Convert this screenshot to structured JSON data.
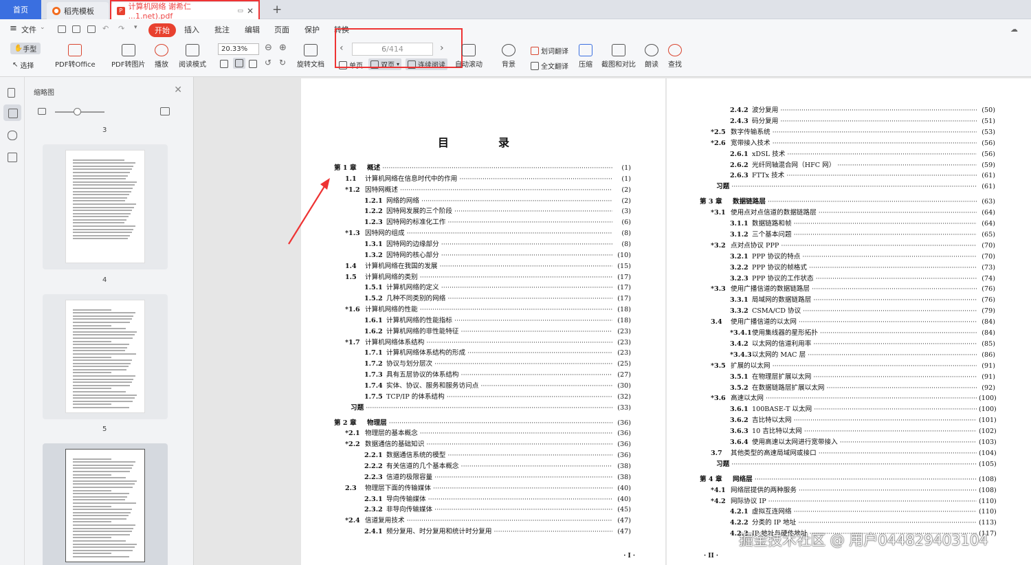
{
  "tabs": {
    "home": "首页",
    "template": "稻壳模板",
    "pdf": "计算机网络 谢希仁 ...1.net).pdf"
  },
  "menu": [
    "文件",
    "开始",
    "插入",
    "批注",
    "编辑",
    "页面",
    "保护",
    "转换"
  ],
  "toolbar": {
    "hand": "手型",
    "select": "选择",
    "pdf_office": "PDF转Office",
    "pdf_img": "PDF转图片",
    "play": "播放",
    "read_mode": "阅读模式",
    "zoom": "20.33%",
    "rotate": "旋转文档",
    "page_current": "6",
    "page_total": "/414",
    "single": "单页",
    "double": "双页",
    "continuous": "连续阅读",
    "autoscroll": "自动滚动",
    "background": "背景",
    "word_translate": "划词翻译",
    "full_translate": "全文翻译",
    "compress": "压缩",
    "screenshot_compare": "截图和对比",
    "read_aloud": "朗读",
    "search": "查找"
  },
  "thumbs": {
    "title": "缩略图",
    "pages": [
      "3",
      "4",
      "5"
    ]
  },
  "doc": {
    "title": "目　录",
    "footer_left": "· I ·",
    "footer_right": "· II ·",
    "left": [
      {
        "n": "第 1 章",
        "t": "概述",
        "p": "(1)",
        "k": "ch"
      },
      {
        "n": "1.1",
        "t": "计算机网络在信息时代中的作用",
        "p": "(1)",
        "k": "s"
      },
      {
        "n": "*1.2",
        "t": "因特网概述",
        "p": "(2)",
        "k": "s"
      },
      {
        "n": "1.2.1",
        "t": "网络的网络",
        "p": "(2)",
        "k": "ss"
      },
      {
        "n": "1.2.2",
        "t": "因特网发展的三个阶段",
        "p": "(3)",
        "k": "ss"
      },
      {
        "n": "1.2.3",
        "t": "因特网的标准化工作",
        "p": "(6)",
        "k": "ss"
      },
      {
        "n": "*1.3",
        "t": "因特网的组成",
        "p": "(8)",
        "k": "s"
      },
      {
        "n": "1.3.1",
        "t": "因特网的边缘部分",
        "p": "(8)",
        "k": "ss"
      },
      {
        "n": "1.3.2",
        "t": "因特网的核心部分",
        "p": "(10)",
        "k": "ss"
      },
      {
        "n": "1.4",
        "t": "计算机网络在我国的发展",
        "p": "(15)",
        "k": "s"
      },
      {
        "n": "1.5",
        "t": "计算机网络的类别",
        "p": "(17)",
        "k": "s"
      },
      {
        "n": "1.5.1",
        "t": "计算机网络的定义",
        "p": "(17)",
        "k": "ss"
      },
      {
        "n": "1.5.2",
        "t": "几种不同类别的网络",
        "p": "(17)",
        "k": "ss"
      },
      {
        "n": "*1.6",
        "t": "计算机网络的性能",
        "p": "(18)",
        "k": "s"
      },
      {
        "n": "1.6.1",
        "t": "计算机网络的性能指标",
        "p": "(18)",
        "k": "ss"
      },
      {
        "n": "1.6.2",
        "t": "计算机网络的非性能特征",
        "p": "(23)",
        "k": "ss"
      },
      {
        "n": "*1.7",
        "t": "计算机网络体系结构",
        "p": "(23)",
        "k": "s"
      },
      {
        "n": "1.7.1",
        "t": "计算机网络体系结构的形成",
        "p": "(23)",
        "k": "ss"
      },
      {
        "n": "1.7.2",
        "t": "协议与划分层次",
        "p": "(25)",
        "k": "ss"
      },
      {
        "n": "1.7.3",
        "t": "具有五层协议的体系结构",
        "p": "(27)",
        "k": "ss"
      },
      {
        "n": "1.7.4",
        "t": "实体、协议、服务和服务访问点",
        "p": "(30)",
        "k": "ss"
      },
      {
        "n": "1.7.5",
        "t": "TCP/IP 的体系结构",
        "p": "(32)",
        "k": "ss"
      },
      {
        "n": "",
        "t": "习题",
        "p": "(33)",
        "k": "ex"
      },
      {
        "n": "第 2 章",
        "t": "物理层",
        "p": "(36)",
        "k": "ch"
      },
      {
        "n": "*2.1",
        "t": "物理层的基本概念",
        "p": "(36)",
        "k": "s"
      },
      {
        "n": "*2.2",
        "t": "数据通信的基础知识",
        "p": "(36)",
        "k": "s"
      },
      {
        "n": "2.2.1",
        "t": "数据通信系统的模型",
        "p": "(36)",
        "k": "ss"
      },
      {
        "n": "2.2.2",
        "t": "有关信道的几个基本概念",
        "p": "(38)",
        "k": "ss"
      },
      {
        "n": "2.2.3",
        "t": "信道的极限容量",
        "p": "(38)",
        "k": "ss"
      },
      {
        "n": "2.3",
        "t": "物理层下面的传输媒体",
        "p": "(40)",
        "k": "s"
      },
      {
        "n": "2.3.1",
        "t": "导向传输媒体",
        "p": "(40)",
        "k": "ss"
      },
      {
        "n": "2.3.2",
        "t": "非导向传输媒体",
        "p": "(45)",
        "k": "ss"
      },
      {
        "n": "*2.4",
        "t": "信道复用技术",
        "p": "(47)",
        "k": "s"
      },
      {
        "n": "2.4.1",
        "t": "频分复用、时分复用和统计时分复用",
        "p": "(47)",
        "k": "ss"
      }
    ],
    "right": [
      {
        "n": "2.4.2",
        "t": "波分复用",
        "p": "(50)",
        "k": "ss"
      },
      {
        "n": "2.4.3",
        "t": "码分复用",
        "p": "(51)",
        "k": "ss"
      },
      {
        "n": "*2.5",
        "t": "数字传输系统",
        "p": "(53)",
        "k": "s"
      },
      {
        "n": "*2.6",
        "t": "宽带接入技术",
        "p": "(56)",
        "k": "s"
      },
      {
        "n": "2.6.1",
        "t": "xDSL 技术",
        "p": "(56)",
        "k": "ss"
      },
      {
        "n": "2.6.2",
        "t": "光纤同轴混合网（HFC 网）",
        "p": "(59)",
        "k": "ss"
      },
      {
        "n": "2.6.3",
        "t": "FTTx 技术",
        "p": "(61)",
        "k": "ss"
      },
      {
        "n": "",
        "t": "习题",
        "p": "(61)",
        "k": "ex"
      },
      {
        "n": "第 3 章",
        "t": "数据链路层",
        "p": "(63)",
        "k": "ch"
      },
      {
        "n": "*3.1",
        "t": "使用点对点信道的数据链路层",
        "p": "(64)",
        "k": "s"
      },
      {
        "n": "3.1.1",
        "t": "数据链路和帧",
        "p": "(64)",
        "k": "ss"
      },
      {
        "n": "3.1.2",
        "t": "三个基本问题",
        "p": "(65)",
        "k": "ss"
      },
      {
        "n": "*3.2",
        "t": "点对点协议 PPP",
        "p": "(70)",
        "k": "s"
      },
      {
        "n": "3.2.1",
        "t": "PPP 协议的特点",
        "p": "(70)",
        "k": "ss"
      },
      {
        "n": "3.2.2",
        "t": "PPP 协议的帧格式",
        "p": "(73)",
        "k": "ss"
      },
      {
        "n": "3.2.3",
        "t": "PPP 协议的工作状态",
        "p": "(74)",
        "k": "ss"
      },
      {
        "n": "*3.3",
        "t": "使用广播信道的数据链路层",
        "p": "(76)",
        "k": "s"
      },
      {
        "n": "3.3.1",
        "t": "局域网的数据链路层",
        "p": "(76)",
        "k": "ss"
      },
      {
        "n": "3.3.2",
        "t": "CSMA/CD 协议",
        "p": "(79)",
        "k": "ss"
      },
      {
        "n": "3.4",
        "t": "使用广播信道的以太网",
        "p": "(84)",
        "k": "s"
      },
      {
        "n": "*3.4.1",
        "t": "使用集线器的星形拓扑",
        "p": "(84)",
        "k": "ss"
      },
      {
        "n": "3.4.2",
        "t": "以太网的信道利用率",
        "p": "(85)",
        "k": "ss"
      },
      {
        "n": "*3.4.3",
        "t": "以太网的 MAC 层",
        "p": "(86)",
        "k": "ss"
      },
      {
        "n": "*3.5",
        "t": "扩展的以太网",
        "p": "(91)",
        "k": "s"
      },
      {
        "n": "3.5.1",
        "t": "在物理层扩展以太网",
        "p": "(91)",
        "k": "ss"
      },
      {
        "n": "3.5.2",
        "t": "在数据链路层扩展以太网",
        "p": "(92)",
        "k": "ss"
      },
      {
        "n": "*3.6",
        "t": "高速以太网",
        "p": "(100)",
        "k": "s"
      },
      {
        "n": "3.6.1",
        "t": "100BASE-T 以太网",
        "p": "(100)",
        "k": "ss"
      },
      {
        "n": "3.6.2",
        "t": "吉比特以太网",
        "p": "(101)",
        "k": "ss"
      },
      {
        "n": "3.6.3",
        "t": "10 吉比特以太网",
        "p": "(102)",
        "k": "ss"
      },
      {
        "n": "3.6.4",
        "t": "使用高速以太网进行宽带接入",
        "p": "(103)",
        "k": "ss"
      },
      {
        "n": "3.7",
        "t": "其他类型的高速局域网或接口",
        "p": "(104)",
        "k": "s"
      },
      {
        "n": "",
        "t": "习题",
        "p": "(105)",
        "k": "ex"
      },
      {
        "n": "第 4 章",
        "t": "网络层",
        "p": "(108)",
        "k": "ch"
      },
      {
        "n": "*4.1",
        "t": "网络层提供的两种服务",
        "p": "(108)",
        "k": "s"
      },
      {
        "n": "*4.2",
        "t": "网际协议 IP",
        "p": "(110)",
        "k": "s"
      },
      {
        "n": "4.2.1",
        "t": "虚拟互连网络",
        "p": "(110)",
        "k": "ss"
      },
      {
        "n": "4.2.2",
        "t": "分类的 IP 地址",
        "p": "(113)",
        "k": "ss"
      },
      {
        "n": "4.2.3",
        "t": "IP 地址与硬件地址",
        "p": "(117)",
        "k": "ss"
      }
    ]
  },
  "watermark": "掘金技术社区 @ 用户044829403104"
}
